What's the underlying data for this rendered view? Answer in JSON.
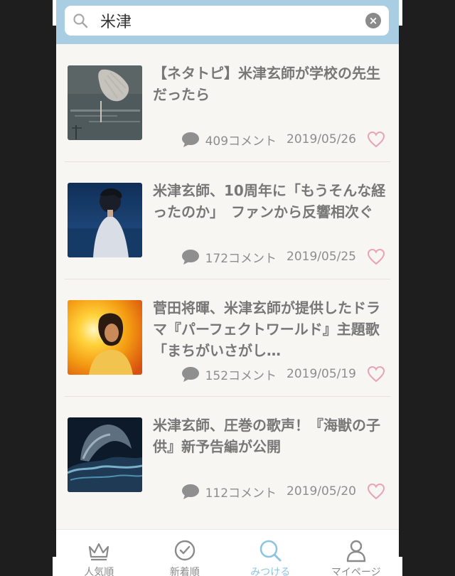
{
  "search": {
    "value": "米津",
    "clear": "×"
  },
  "articles": [
    {
      "title": "【ネタトピ】米津玄師が学校の先生だったら",
      "comments": "409コメント",
      "date": "2019/05/26"
    },
    {
      "title": "米津玄師、10周年に「もうそんな経ったのか」　ファンから反響相次ぐ",
      "comments": "172コメント",
      "date": "2019/05/25"
    },
    {
      "title": "菅田将暉、米津玄師が提供したドラマ『パーフェクトワールド』主題歌「まちがいさがし…",
      "comments": "152コメント",
      "date": "2019/05/19"
    },
    {
      "title": "米津玄師、圧巻の歌声！『海獣の子供』新予告編が公開",
      "comments": "112コメント",
      "date": "2019/05/20"
    }
  ],
  "tabs": [
    {
      "label": "人気順",
      "icon": "crown-icon"
    },
    {
      "label": "新着順",
      "icon": "clock-icon"
    },
    {
      "label": "みつける",
      "icon": "search-icon",
      "active": true
    },
    {
      "label": "マイページ",
      "icon": "person-icon"
    }
  ],
  "colors": {
    "accent": "#8dc4e0",
    "search_bar": "#a9cde3",
    "heart": "#e9a3b3",
    "text": "#777777"
  }
}
